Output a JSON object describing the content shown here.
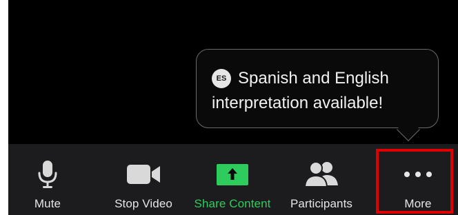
{
  "tooltip": {
    "badge": "ES",
    "line1": "Spanish and English",
    "line2": "interpretation available!"
  },
  "toolbar": {
    "items": [
      {
        "label": "Mute",
        "icon": "microphone-icon"
      },
      {
        "label": "Stop Video",
        "icon": "video-camera-icon"
      },
      {
        "label": "Share Content",
        "icon": "share-arrow-icon"
      },
      {
        "label": "Participants",
        "icon": "participants-icon"
      },
      {
        "label": "More",
        "icon": "more-dots-icon"
      }
    ]
  },
  "colors": {
    "toolbar_bg": "#1c1c1e",
    "share_green": "#2ecc5c",
    "highlight_red": "#e00000",
    "tooltip_border": "#6b6b6b"
  }
}
